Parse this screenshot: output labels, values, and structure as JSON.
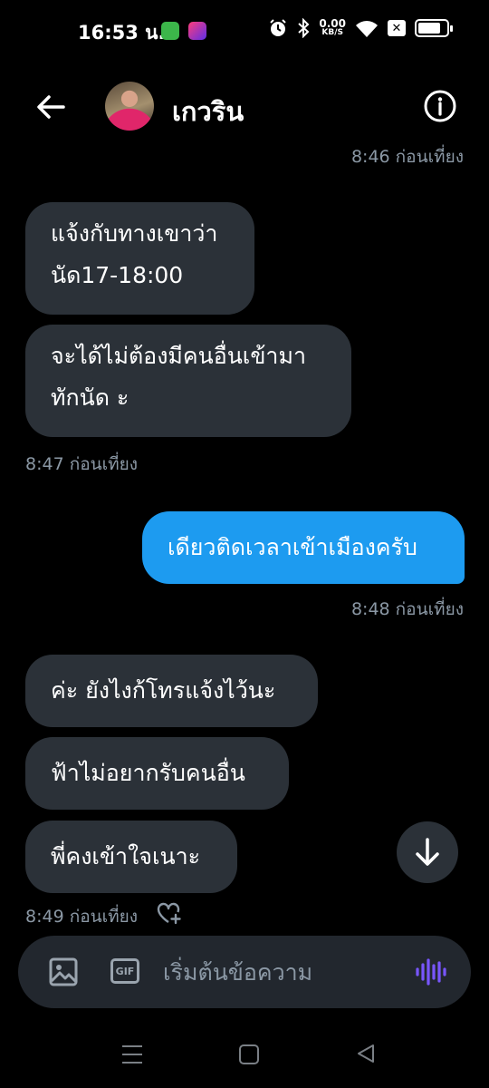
{
  "status_bar": {
    "time": "16:53 น.",
    "net_speed": "0.00",
    "net_unit": "KB/S",
    "battery_level": 0.8
  },
  "header": {
    "contact_name": "เกวริน"
  },
  "messages": [
    {
      "type": "timestamp",
      "text": "8:46 ก่อนเที่ยง"
    },
    {
      "type": "incoming",
      "text": "แจ้งกับทางเขาว่านัด17-18:00"
    },
    {
      "type": "incoming",
      "text": "จะได้ไม่ต้องมีคนอื่นเข้ามาทักนัด ะ"
    },
    {
      "type": "timestamp",
      "text": "8:47 ก่อนเที่ยง"
    },
    {
      "type": "outgoing",
      "text": "เดียวติดเวลาเข้าเมืองครับ"
    },
    {
      "type": "timestamp",
      "text": "8:48 ก่อนเที่ยง"
    },
    {
      "type": "incoming",
      "text": "ค่ะ ยังไงก้โทรแจ้งไว้นะ"
    },
    {
      "type": "incoming",
      "text": "ฟ้าไม่อยากรับคนอื่น"
    },
    {
      "type": "incoming",
      "text": "พี่คงเข้าใจเนาะ"
    },
    {
      "type": "timestamp",
      "text": "8:49 ก่อนเที่ยง"
    }
  ],
  "bubble_lines": {
    "m1a": "แจ้งกับทางเขาว่า",
    "m1b": "นัด17-18:00",
    "m2a": "จะได้ไม่ต้องมีคนอื่นเข้ามา",
    "m2b": "ทักนัด ะ"
  },
  "composer": {
    "placeholder": "เริ่มต้นข้อความ",
    "gif_label": "GIF"
  },
  "colors": {
    "accent": "#1d9bf0",
    "incoming_bubble": "#2b3138",
    "voice": "#7856ff"
  },
  "icons": [
    "back-arrow-icon",
    "info-icon",
    "heart-plus-icon",
    "arrow-down-icon",
    "image-icon",
    "gif-icon",
    "voice-wave-icon"
  ]
}
